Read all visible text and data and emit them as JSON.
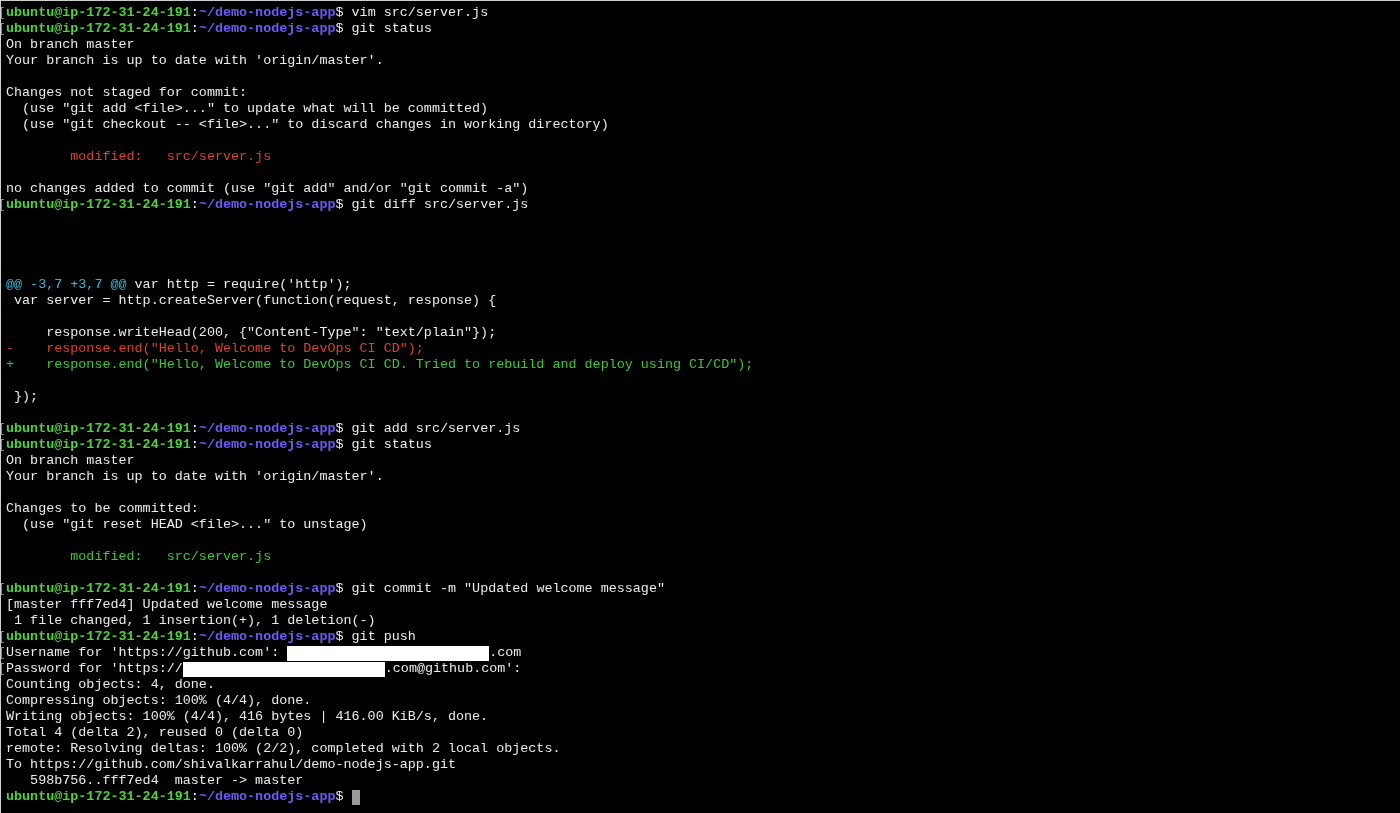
{
  "terminal": {
    "lines": [
      {
        "marked": true,
        "segments": [
          {
            "kind": "user",
            "text": "ubuntu@ip-172-31-24-191"
          },
          {
            "kind": "plain",
            "text": ":"
          },
          {
            "kind": "path",
            "text": "~/demo-nodejs-app"
          },
          {
            "kind": "plain",
            "text": "$ vim src/server.js"
          }
        ]
      },
      {
        "marked": true,
        "segments": [
          {
            "kind": "user",
            "text": "ubuntu@ip-172-31-24-191"
          },
          {
            "kind": "plain",
            "text": ":"
          },
          {
            "kind": "path",
            "text": "~/demo-nodejs-app"
          },
          {
            "kind": "plain",
            "text": "$ git status"
          }
        ]
      },
      {
        "marked": false,
        "segments": [
          {
            "kind": "plain",
            "text": "On branch master"
          }
        ]
      },
      {
        "marked": false,
        "segments": [
          {
            "kind": "plain",
            "text": "Your branch is up to date with 'origin/master'."
          }
        ]
      },
      {
        "marked": false
      },
      {
        "marked": false,
        "segments": [
          {
            "kind": "plain",
            "text": "Changes not staged for commit:"
          }
        ]
      },
      {
        "marked": false,
        "segments": [
          {
            "kind": "plain",
            "text": "  (use \"git add <file>...\" to update what will be committed)"
          }
        ]
      },
      {
        "marked": false,
        "segments": [
          {
            "kind": "plain",
            "text": "  (use \"git checkout -- <file>...\" to discard changes in working directory)"
          }
        ]
      },
      {
        "marked": false
      },
      {
        "marked": false,
        "segments": [
          {
            "kind": "removed",
            "text": "        modified:   src/server.js"
          }
        ]
      },
      {
        "marked": false
      },
      {
        "marked": false,
        "segments": [
          {
            "kind": "plain",
            "text": "no changes added to commit (use \"git add\" and/or \"git commit -a\")"
          }
        ]
      },
      {
        "marked": true,
        "segments": [
          {
            "kind": "user",
            "text": "ubuntu@ip-172-31-24-191"
          },
          {
            "kind": "plain",
            "text": ":"
          },
          {
            "kind": "path",
            "text": "~/demo-nodejs-app"
          },
          {
            "kind": "plain",
            "text": "$ git diff src/server.js"
          }
        ]
      },
      {
        "marked": false
      },
      {
        "marked": false
      },
      {
        "marked": false
      },
      {
        "marked": false
      },
      {
        "marked": false,
        "segments": [
          {
            "kind": "hunk",
            "text": "@@ -3,7 +3,7 @@"
          },
          {
            "kind": "plain",
            "text": " var http = require('http');"
          }
        ]
      },
      {
        "marked": false,
        "segments": [
          {
            "kind": "plain",
            "text": " var server = http.createServer(function(request, response) {"
          }
        ]
      },
      {
        "marked": false
      },
      {
        "marked": false,
        "segments": [
          {
            "kind": "plain",
            "text": "     response.writeHead(200, {\"Content-Type\": \"text/plain\"});"
          }
        ]
      },
      {
        "marked": false,
        "segments": [
          {
            "kind": "removed",
            "text": "-    response.end(\"Hello, Welcome to DevOps CI CD\");"
          }
        ]
      },
      {
        "marked": false,
        "segments": [
          {
            "kind": "added",
            "text": "+    response.end(\"Hello, Welcome to DevOps CI CD. Tried to rebuild and deploy using CI/CD\");"
          }
        ]
      },
      {
        "marked": false
      },
      {
        "marked": false,
        "segments": [
          {
            "kind": "plain",
            "text": " });"
          }
        ]
      },
      {
        "marked": false
      },
      {
        "marked": true,
        "segments": [
          {
            "kind": "user",
            "text": "ubuntu@ip-172-31-24-191"
          },
          {
            "kind": "plain",
            "text": ":"
          },
          {
            "kind": "path",
            "text": "~/demo-nodejs-app"
          },
          {
            "kind": "plain",
            "text": "$ git add src/server.js"
          }
        ]
      },
      {
        "marked": true,
        "segments": [
          {
            "kind": "user",
            "text": "ubuntu@ip-172-31-24-191"
          },
          {
            "kind": "plain",
            "text": ":"
          },
          {
            "kind": "path",
            "text": "~/demo-nodejs-app"
          },
          {
            "kind": "plain",
            "text": "$ git status"
          }
        ]
      },
      {
        "marked": false,
        "segments": [
          {
            "kind": "plain",
            "text": "On branch master"
          }
        ]
      },
      {
        "marked": false,
        "segments": [
          {
            "kind": "plain",
            "text": "Your branch is up to date with 'origin/master'."
          }
        ]
      },
      {
        "marked": false
      },
      {
        "marked": false,
        "segments": [
          {
            "kind": "plain",
            "text": "Changes to be committed:"
          }
        ]
      },
      {
        "marked": false,
        "segments": [
          {
            "kind": "plain",
            "text": "  (use \"git reset HEAD <file>...\" to unstage)"
          }
        ]
      },
      {
        "marked": false
      },
      {
        "marked": false,
        "segments": [
          {
            "kind": "added",
            "text": "        modified:   src/server.js"
          }
        ]
      },
      {
        "marked": false
      },
      {
        "marked": true,
        "segments": [
          {
            "kind": "user",
            "text": "ubuntu@ip-172-31-24-191"
          },
          {
            "kind": "plain",
            "text": ":"
          },
          {
            "kind": "path",
            "text": "~/demo-nodejs-app"
          },
          {
            "kind": "plain",
            "text": "$ git commit -m \"Updated welcome message\""
          }
        ]
      },
      {
        "marked": false,
        "segments": [
          {
            "kind": "plain",
            "text": "[master fff7ed4] Updated welcome message"
          }
        ]
      },
      {
        "marked": false,
        "segments": [
          {
            "kind": "plain",
            "text": " 1 file changed, 1 insertion(+), 1 deletion(-)"
          }
        ]
      },
      {
        "marked": true,
        "segments": [
          {
            "kind": "user",
            "text": "ubuntu@ip-172-31-24-191"
          },
          {
            "kind": "plain",
            "text": ":"
          },
          {
            "kind": "path",
            "text": "~/demo-nodejs-app"
          },
          {
            "kind": "plain",
            "text": "$ git push"
          }
        ]
      },
      {
        "marked": true,
        "segments": [
          {
            "kind": "plain",
            "text": "Username for 'https://github.com': "
          },
          {
            "kind": "redacted"
          },
          {
            "kind": "plain",
            "text": ".com"
          }
        ]
      },
      {
        "marked": true,
        "segments": [
          {
            "kind": "plain",
            "text": "Password for 'https://"
          },
          {
            "kind": "redacted"
          },
          {
            "kind": "plain",
            "text": ".com@github.com':"
          }
        ]
      },
      {
        "marked": false,
        "segments": [
          {
            "kind": "plain",
            "text": "Counting objects: 4, done."
          }
        ]
      },
      {
        "marked": false,
        "segments": [
          {
            "kind": "plain",
            "text": "Compressing objects: 100% (4/4), done."
          }
        ]
      },
      {
        "marked": false,
        "segments": [
          {
            "kind": "plain",
            "text": "Writing objects: 100% (4/4), 416 bytes | 416.00 KiB/s, done."
          }
        ]
      },
      {
        "marked": false,
        "segments": [
          {
            "kind": "plain",
            "text": "Total 4 (delta 2), reused 0 (delta 0)"
          }
        ]
      },
      {
        "marked": false,
        "segments": [
          {
            "kind": "plain",
            "text": "remote: Resolving deltas: 100% (2/2), completed with 2 local objects."
          }
        ]
      },
      {
        "marked": false,
        "segments": [
          {
            "kind": "plain",
            "text": "To https://github.com/shivalkarrahul/demo-nodejs-app.git"
          }
        ]
      },
      {
        "marked": false,
        "segments": [
          {
            "kind": "plain",
            "text": "   598b756..fff7ed4  master -> master"
          }
        ]
      },
      {
        "marked": false,
        "segments": [
          {
            "kind": "user",
            "text": "ubuntu@ip-172-31-24-191"
          },
          {
            "kind": "plain",
            "text": ":"
          },
          {
            "kind": "path",
            "text": "~/demo-nodejs-app"
          },
          {
            "kind": "plain",
            "text": "$ "
          },
          {
            "kind": "cursor"
          }
        ]
      }
    ]
  }
}
